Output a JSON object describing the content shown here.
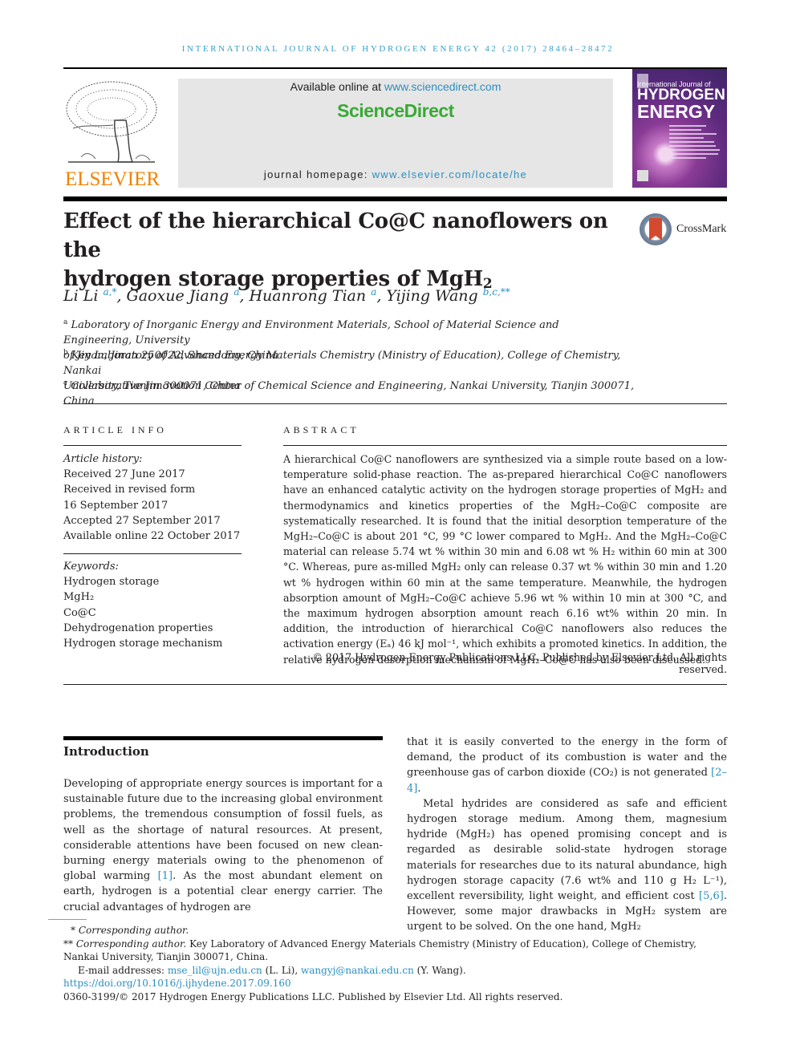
{
  "header": {
    "running_head": "International Journal of Hydrogen Energy 42 (2017) 28464–28472",
    "publisher_wordmark": "ELSEVIER",
    "available_online_prefix": "Available online at ",
    "available_online_link": "www.sciencedirect.com",
    "platform_name": "ScienceDirect",
    "homepage_prefix": "journal homepage: ",
    "homepage_link": "www.elsevier.com/locate/he",
    "cover": {
      "line1": "International Journal of",
      "line2": "HYDROGEN",
      "line3": "ENERGY"
    },
    "crossmark_label": "CrossMark"
  },
  "article": {
    "title_line1": "Effect of the hierarchical Co@C nanoflowers on the",
    "title_line2_main": "hydrogen storage properties of MgH",
    "title_line2_sub": "2",
    "authors": [
      {
        "name": "Li Li",
        "marks": "a,*"
      },
      {
        "name": "Gaoxue Jiang",
        "marks": "a"
      },
      {
        "name": "Huanrong Tian",
        "marks": "a"
      },
      {
        "name": "Yijing Wang",
        "marks": "b,c,**"
      }
    ],
    "affiliations": [
      {
        "mark": "a",
        "line1": "Laboratory of Inorganic Energy and Environment Materials, School of Material Science and Engineering, University",
        "line2": "of Jinan, Jinan 250022, Shandong, China"
      },
      {
        "mark": "b",
        "line1": "Key Laboratory of Advanced Energy Materials Chemistry (Ministry of Education), College of Chemistry, Nankai",
        "line2": "University, Tianjin 300071, China"
      },
      {
        "mark": "c",
        "line1": "Collaborative Innovation Center of Chemical Science and Engineering, Nankai University, Tianjin 300071, China",
        "line2": ""
      }
    ]
  },
  "article_info": {
    "heading": "ARTICLE INFO",
    "history_label": "Article history:",
    "history": [
      "Received 27 June 2017",
      "Received in revised form",
      "16 September 2017",
      "Accepted 27 September 2017",
      "Available online 22 October 2017"
    ],
    "keywords_label": "Keywords:",
    "keywords": [
      "Hydrogen storage",
      "MgH₂",
      "Co@C",
      "Dehydrogenation properties",
      "Hydrogen storage mechanism"
    ]
  },
  "abstract": {
    "heading": "ABSTRACT",
    "text": "A hierarchical Co@C nanoflowers are synthesized via a simple route based on a low-temperature solid-phase reaction. The as-prepared hierarchical Co@C nanoflowers have an enhanced catalytic activity on the hydrogen storage properties of MgH₂ and thermodynamics and kinetics properties of the MgH₂–Co@C composite are systematically researched. It is found that the initial desorption temperature of the MgH₂–Co@C is about 201 °C, 99 °C lower compared to MgH₂. And the MgH₂–Co@C material can release 5.74 wt % within 30 min and 6.08 wt % H₂ within 60 min at 300 °C. Whereas, pure as-milled MgH₂ only can release 0.37 wt % within 30 min and 1.20 wt % hydrogen within 60 min at the same temperature. Meanwhile, the hydrogen absorption amount of MgH₂–Co@C achieve 5.96 wt % within 10 min at 300 °C, and the maximum hydrogen absorption amount reach 6.16 wt% within 20 min. In addition, the introduction of hierarchical Co@C nanoflowers also reduces the activation energy (Eₐ) 46 kJ mol⁻¹, which exhibits a promoted kinetics. In addition, the relative hydrogen desorption mechanism of MgH₂–Co@C has also been discussed.",
    "copyright": "© 2017 Hydrogen Energy Publications LLC. Published by Elsevier Ltd. All rights reserved."
  },
  "introduction": {
    "heading": "Introduction",
    "left_text_before_ref": "Developing of appropriate energy sources is important for a sustainable future due to the increasing global environment problems, the tremendous consumption of fossil fuels, as well as the shortage of natural resources. At present, considerable attentions have been focused on new clean-burning energy materials owing to the phenomenon of global warming ",
    "left_ref": "[1]",
    "left_text_after_ref": ". As the most abundant element on earth, hydrogen is a potential clear energy carrier. The crucial advantages of hydrogen are",
    "right_p1_before_ref": "that it is easily converted to the energy in the form of demand, the product of its combustion is water and the greenhouse gas of carbon dioxide (CO₂) is not generated ",
    "right_p1_ref": "[2–4]",
    "right_p1_after_ref": ".",
    "right_p2_before_ref": "Metal hydrides are considered as safe and efficient hydrogen storage medium. Among them, magnesium hydride (MgH₂) has opened promising concept and is regarded as desirable solid-state hydrogen storage materials for researches due to its natural abundance, high hydrogen storage capacity (7.6 wt% and 110 g H₂ L⁻¹), excellent reversibility, light weight, and efficient cost ",
    "right_p2_ref": "[5,6]",
    "right_p2_after_ref": ". However, some major drawbacks in MgH₂ system are urgent to be solved. On the one hand, MgH₂"
  },
  "footnotes": {
    "fn1_mark": "*",
    "fn1_label": "Corresponding author.",
    "fn2_mark": "**",
    "fn2_label": "Corresponding author.",
    "fn2_text": " Key Laboratory of Advanced Energy Materials Chemistry (Ministry of Education), College of Chemistry, Nankai University, Tianjin 300071, China.",
    "email_label": "E-mail addresses: ",
    "email1": "mse_lil@ujn.edu.cn",
    "email1_owner": " (L. Li), ",
    "email2": "wangyj@nankai.edu.cn",
    "email2_owner": " (Y. Wang).",
    "doi": "https://doi.org/10.1016/j.ijhydene.2017.09.160",
    "issn_copyright": "0360-3199/© 2017 Hydrogen Energy Publications LLC. Published by Elsevier Ltd. All rights reserved."
  },
  "colors": {
    "link": "#2a8fc0",
    "elsevier_orange": "#f08200",
    "sciencedirect_green": "#3aa935",
    "running_head": "#3a9fc7"
  }
}
